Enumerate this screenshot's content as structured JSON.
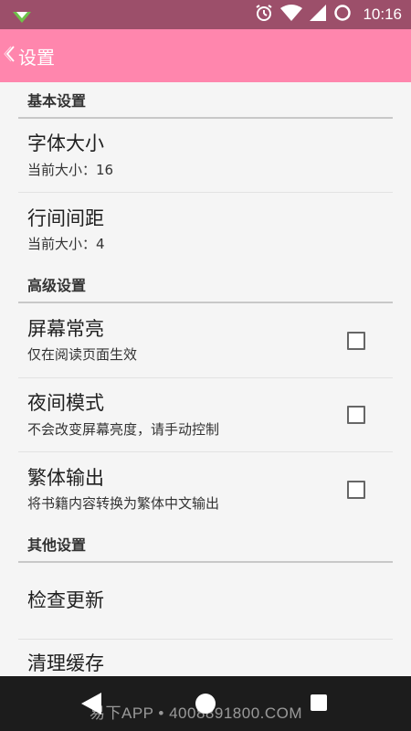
{
  "status_bar": {
    "time": "10:16",
    "icons": [
      "app-notification-icon",
      "alarm-icon",
      "wifi-icon",
      "signal-icon",
      "battery-icon"
    ]
  },
  "app_bar": {
    "back_label": "设置",
    "background_color": "#ff86ad"
  },
  "sections": {
    "basic": {
      "header": "基本设置",
      "font_size": {
        "title": "字体大小",
        "summary": "当前大小：16"
      },
      "line_spacing": {
        "title": "行间间距",
        "summary": "当前大小：4"
      }
    },
    "advanced": {
      "header": "高级设置",
      "screen_on": {
        "title": "屏幕常亮",
        "summary": "仅在阅读页面生效",
        "checked": false
      },
      "night_mode": {
        "title": "夜间模式",
        "summary": "不会改变屏幕亮度，请手动控制",
        "checked": false
      },
      "traditional": {
        "title": "繁体输出",
        "summary": "将书籍内容转换为繁体中文输出",
        "checked": false
      }
    },
    "other": {
      "header": "其他设置",
      "check_update": {
        "title": "检查更新"
      },
      "clear_cache": {
        "title": "清理缓存"
      }
    }
  },
  "nav_bar": {
    "watermark": "易下APP • 4008891800.COM"
  }
}
